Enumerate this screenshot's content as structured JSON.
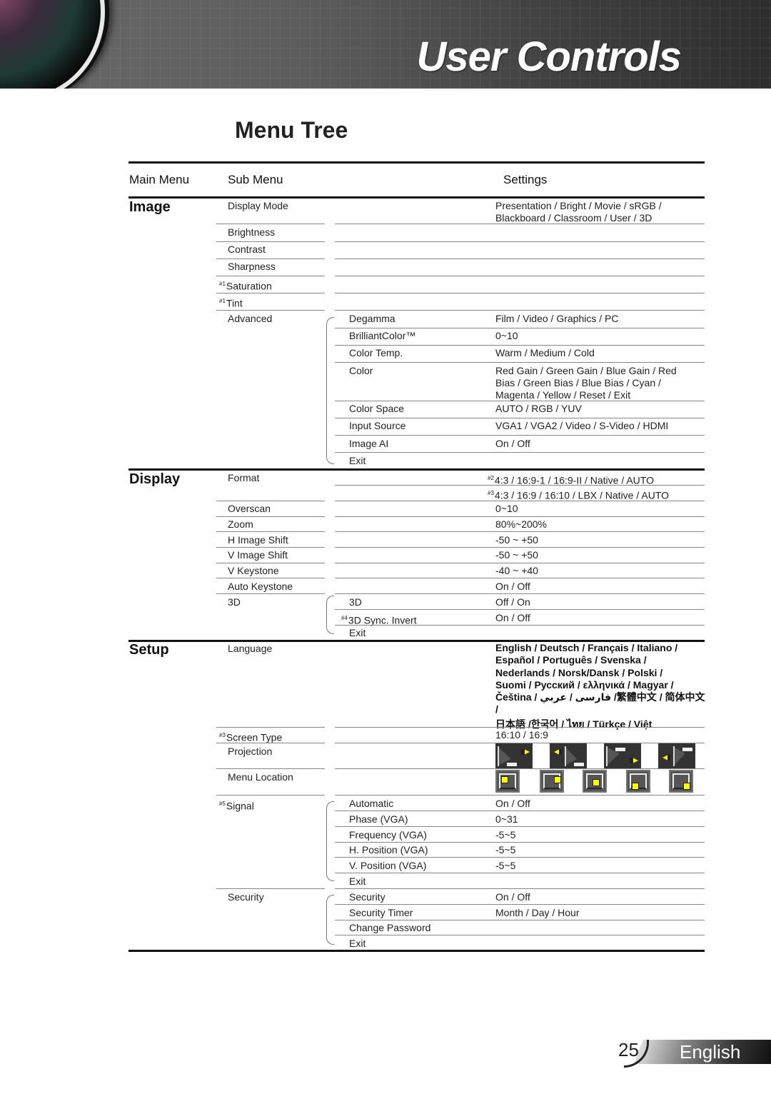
{
  "header": {
    "title": "User Controls"
  },
  "page_title": "Menu Tree",
  "columns": {
    "main": "Main Menu",
    "sub": "Sub Menu",
    "settings": "Settings"
  },
  "image": {
    "label": "Image",
    "display_mode": {
      "label": "Display Mode",
      "value_line1": "Presentation / Bright / Movie / sRGB /",
      "value_line2": "Blackboard / Classroom / User / 3D"
    },
    "brightness": "Brightness",
    "contrast": "Contrast",
    "sharpness": "Sharpness",
    "saturation": {
      "note": "#1",
      "label": "Saturation"
    },
    "tint": {
      "note": "#1",
      "label": "Tint"
    },
    "advanced": {
      "label": "Advanced",
      "items": [
        {
          "label": "Degamma",
          "value": "Film / Video / Graphics / PC"
        },
        {
          "label": "BrilliantColor™",
          "value": "0~10"
        },
        {
          "label": "Color Temp.",
          "value": "Warm / Medium / Cold"
        },
        {
          "label": "Color",
          "value_line1": "Red Gain / Green Gain / Blue Gain / Red",
          "value_line2": "Bias / Green Bias / Blue Bias / Cyan /",
          "value_line3": "Magenta / Yellow / Reset / Exit"
        },
        {
          "label": "Color Space",
          "value": "AUTO / RGB / YUV"
        },
        {
          "label": "Input Source",
          "value": "VGA1 / VGA2 / Video / S-Video / HDMI"
        },
        {
          "label": "Image AI",
          "value": "On / Off"
        },
        {
          "label": "Exit"
        }
      ]
    }
  },
  "display": {
    "label": "Display",
    "format": {
      "label": "Format",
      "note1": "#2",
      "value1": "4:3 / 16:9-1 / 16:9-II / Native / AUTO",
      "note2": "#3",
      "value2": "4:3 / 16:9 / 16:10 / LBX / Native / AUTO"
    },
    "rows": [
      {
        "label": "Overscan",
        "value": "0~10"
      },
      {
        "label": "Zoom",
        "value": "80%~200%"
      },
      {
        "label": "H Image Shift",
        "value": "-50 ~ +50"
      },
      {
        "label": "V Image Shift",
        "value": "-50 ~ +50"
      },
      {
        "label": "V Keystone",
        "value": "-40 ~ +40"
      },
      {
        "label": "Auto Keystone",
        "value": "On / Off"
      }
    ],
    "three_d": {
      "label": "3D",
      "items": [
        {
          "label": "3D",
          "value": "Off / On"
        },
        {
          "note": "#4",
          "label": "3D Sync. Invert",
          "value": "On / Off"
        },
        {
          "label": "Exit"
        }
      ]
    }
  },
  "setup": {
    "label": "Setup",
    "language": {
      "label": "Language",
      "lines": [
        "English / Deutsch / Français / Italiano /",
        "Español / Português / Svenska /",
        "Nederlands / Norsk/Dansk / Polski /",
        "Suomi / Русский / ελληνικά / Magyar /",
        "Čeština / فارسی / عربي /繁體中文 / 简体中文 /",
        "日本語  /한국어 / ไทย / Türkçe / Việt"
      ]
    },
    "screen_type": {
      "note": "#3",
      "label": "Screen Type",
      "value": "16:10 / 16:9"
    },
    "projection": {
      "label": "Projection",
      "options": [
        "front-desktop-icon",
        "rear-desktop-icon",
        "front-ceiling-icon",
        "rear-ceiling-icon"
      ]
    },
    "menu_location": {
      "label": "Menu Location",
      "options": [
        "top-left-icon",
        "top-right-icon",
        "center-icon",
        "bottom-left-icon",
        "bottom-right-icon"
      ]
    },
    "signal": {
      "note": "#5",
      "label": "Signal",
      "items": [
        {
          "label": "Automatic",
          "value": "On / Off"
        },
        {
          "label": "Phase (VGA)",
          "value": "0~31"
        },
        {
          "label": "Frequency (VGA)",
          "value": "-5~5"
        },
        {
          "label": "H. Position (VGA)",
          "value": "-5~5"
        },
        {
          "label": "V. Position (VGA)",
          "value": "-5~5"
        },
        {
          "label": "Exit"
        }
      ]
    },
    "security": {
      "label": "Security",
      "items": [
        {
          "label": "Security",
          "value": "On / Off"
        },
        {
          "label": "Security Timer",
          "value": "Month / Day / Hour"
        },
        {
          "label": "Change Password"
        },
        {
          "label": "Exit"
        }
      ]
    }
  },
  "footer": {
    "page_number": "25",
    "language": "English"
  },
  "colors": {
    "header_dark": "#2e2e2e",
    "highlight_yellow": "#ffff00"
  }
}
